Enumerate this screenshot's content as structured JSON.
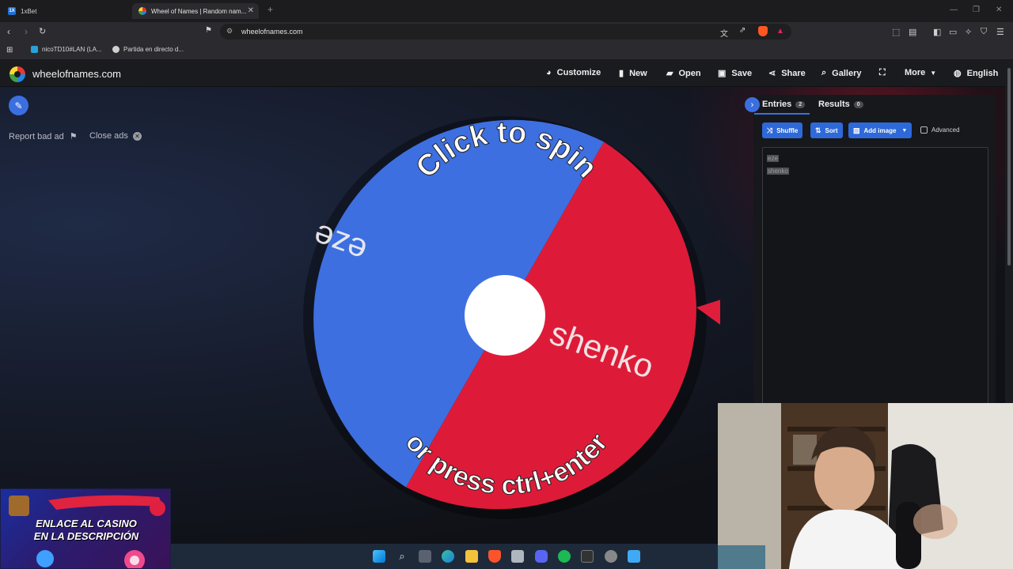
{
  "browser": {
    "tabs": [
      {
        "label": "1xBet",
        "icon": "1xbet-favicon"
      },
      {
        "label": "Wheel of Names | Random nam...",
        "icon": "wheel-favicon"
      }
    ],
    "url": "wheelofnames.com",
    "bookmarks": [
      {
        "label": "nicoTD10#LAN (LA...",
        "icon": "l-favicon"
      },
      {
        "label": "Partida en directo d...",
        "icon": "chess-favicon"
      }
    ]
  },
  "site": {
    "logo_text": "wheelofnames.com",
    "menu": {
      "customize": "Customize",
      "new": "New",
      "open": "Open",
      "save": "Save",
      "share": "Share",
      "gallery": "Gallery",
      "more": "More",
      "language": "English"
    },
    "ads": {
      "report": "Report bad ad",
      "close": "Close ads"
    }
  },
  "wheel": {
    "entries": [
      {
        "name": "eze",
        "color": "#3d6fe0"
      },
      {
        "name": "shenko",
        "color": "#dd1b38"
      }
    ],
    "top_text": "Click to spin",
    "bottom_text": "or press ctrl+enter",
    "pointer_color": "#e01e3c",
    "accent": "#3b6fe0"
  },
  "panel": {
    "tabs": {
      "entries": "Entries",
      "entries_count": "2",
      "results": "Results",
      "results_count": "0"
    },
    "buttons": {
      "shuffle": "Shuffle",
      "sort": "Sort",
      "add_image": "Add image",
      "advanced": "Advanced"
    },
    "entries_text": [
      "eze",
      "shenko"
    ]
  },
  "overlay_ad": {
    "line1": "ENLACE AL CASINO",
    "line2": "EN LA DESCRIPCIÓN"
  }
}
